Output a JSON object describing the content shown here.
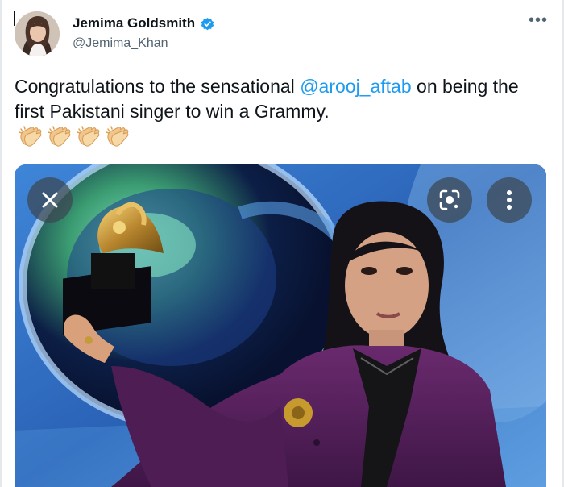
{
  "tweet": {
    "author_name": "Jemima Goldsmith",
    "author_handle": "@Jemima_Khan",
    "verified": true,
    "text_before": "Congratulations to the sensational ",
    "mention": "@arooj_aftab",
    "text_after": " on being the first Pakistani singer to win a Grammy.",
    "emoji": [
      "clapping-hands",
      "clapping-hands",
      "clapping-hands",
      "clapping-hands"
    ],
    "more_icon": "more-horizontal-icon"
  },
  "media_viewer": {
    "close_icon": "close-icon",
    "lens_icon": "google-lens-icon",
    "menu_icon": "more-vertical-icon"
  },
  "colors": {
    "accent": "#1d9bf0",
    "text": "#0f1419",
    "secondary": "#536471",
    "verified": "#1d9bf0"
  }
}
